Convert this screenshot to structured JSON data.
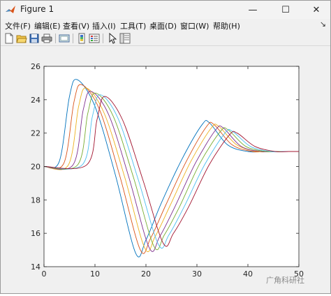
{
  "window": {
    "title": "Figure 1",
    "minimize_glyph": "—",
    "maximize_glyph": "☐",
    "close_glyph": "✕"
  },
  "menu": {
    "items": [
      {
        "label": "文件(F)"
      },
      {
        "label": "编辑(E)"
      },
      {
        "label": "查看(V)"
      },
      {
        "label": "插入(I)"
      },
      {
        "label": "工具(T)"
      },
      {
        "label": "桌面(D)"
      },
      {
        "label": "窗口(W)"
      },
      {
        "label": "帮助(H)"
      }
    ],
    "right_glyph": "↘"
  },
  "toolbar": {
    "buttons": [
      "new-figure-icon",
      "open-file-icon",
      "save-icon",
      "print-icon",
      "link-plot-icon",
      "insert-colorbar-icon",
      "insert-legend-icon",
      "pointer-icon",
      "property-inspector-icon"
    ]
  },
  "watermark": {
    "text": "广角科研社"
  },
  "colors": {
    "series": [
      "#0072BD",
      "#D95319",
      "#EDB120",
      "#7E2F8E",
      "#77AC30",
      "#4DBEEE",
      "#A2142F"
    ]
  },
  "chart_data": {
    "type": "line",
    "title": "",
    "xlabel": "",
    "ylabel": "",
    "xlim": [
      0,
      50
    ],
    "ylim": [
      14,
      26
    ],
    "xticks": [
      0,
      10,
      20,
      30,
      40,
      50
    ],
    "yticks": [
      14,
      16,
      18,
      20,
      22,
      24,
      26
    ],
    "grid": false,
    "legend": "none",
    "series": [
      {
        "color": "#0072BD",
        "x": [
          0,
          3,
          5,
          6.5,
          10,
          14,
          18,
          20,
          23,
          27,
          31,
          32.5,
          36,
          40,
          44,
          50
        ],
        "y": [
          20,
          20.3,
          24.2,
          25.2,
          23.6,
          19.5,
          14.8,
          15.6,
          17.8,
          20.4,
          22.5,
          22.6,
          21.3,
          20.9,
          20.9,
          20.9
        ]
      },
      {
        "color": "#D95319",
        "x": [
          0,
          3.9,
          5.9,
          7.4,
          10.9,
          14.9,
          18.9,
          20.9,
          23.9,
          27.9,
          31.9,
          33.4,
          36.9,
          40.9,
          44,
          50
        ],
        "y": [
          20,
          20.2,
          23.9,
          24.9,
          23.4,
          19.4,
          15.0,
          15.7,
          17.7,
          20.3,
          22.4,
          22.5,
          21.3,
          20.9,
          20.9,
          20.9
        ]
      },
      {
        "color": "#EDB120",
        "x": [
          0,
          4.8,
          6.8,
          8.3,
          11.8,
          15.8,
          19.8,
          21.8,
          24.8,
          28.8,
          32.8,
          34.3,
          37.8,
          41.8,
          45,
          50
        ],
        "y": [
          20,
          20.1,
          23.6,
          24.7,
          23.2,
          19.4,
          15.1,
          15.8,
          17.7,
          20.3,
          22.3,
          22.4,
          21.3,
          20.9,
          20.9,
          20.9
        ]
      },
      {
        "color": "#7E2F8E",
        "x": [
          0,
          5.7,
          7.7,
          9.2,
          12.7,
          16.7,
          20.7,
          22.7,
          25.7,
          29.7,
          33.7,
          35.2,
          38.7,
          42.7,
          46,
          50
        ],
        "y": [
          20,
          20.1,
          23.4,
          24.5,
          23.1,
          19.3,
          15.1,
          15.8,
          17.6,
          20.2,
          22.2,
          22.3,
          21.2,
          20.9,
          20.9,
          20.9
        ]
      },
      {
        "color": "#77AC30",
        "x": [
          0,
          6.6,
          8.6,
          10.1,
          13.6,
          17.6,
          21.6,
          23.6,
          26.6,
          30.6,
          34.6,
          36.1,
          39.6,
          43.6,
          46,
          50
        ],
        "y": [
          20,
          20.1,
          23.2,
          24.4,
          23.0,
          19.3,
          15.2,
          15.9,
          17.6,
          20.2,
          22.1,
          22.2,
          21.2,
          20.9,
          20.9,
          20.9
        ]
      },
      {
        "color": "#4DBEEE",
        "x": [
          0,
          7.5,
          9.5,
          11,
          14.5,
          18.5,
          22.5,
          24.5,
          27.5,
          31.5,
          35.5,
          37,
          40.5,
          44.5,
          47,
          50
        ],
        "y": [
          20,
          20.1,
          23.0,
          24.3,
          22.9,
          19.2,
          15.3,
          15.9,
          17.6,
          20.1,
          22.0,
          22.1,
          21.2,
          20.9,
          20.9,
          20.9
        ]
      },
      {
        "color": "#A2142F",
        "x": [
          0,
          8.4,
          10.4,
          11.9,
          15.4,
          19.4,
          23.4,
          25.4,
          28.4,
          32.4,
          36.4,
          37.9,
          41.4,
          45.4,
          48,
          50
        ],
        "y": [
          20,
          20.1,
          22.8,
          24.2,
          22.8,
          19.2,
          15.4,
          16.0,
          17.6,
          20.1,
          21.9,
          22.0,
          21.2,
          20.9,
          20.9,
          20.9
        ]
      }
    ]
  }
}
